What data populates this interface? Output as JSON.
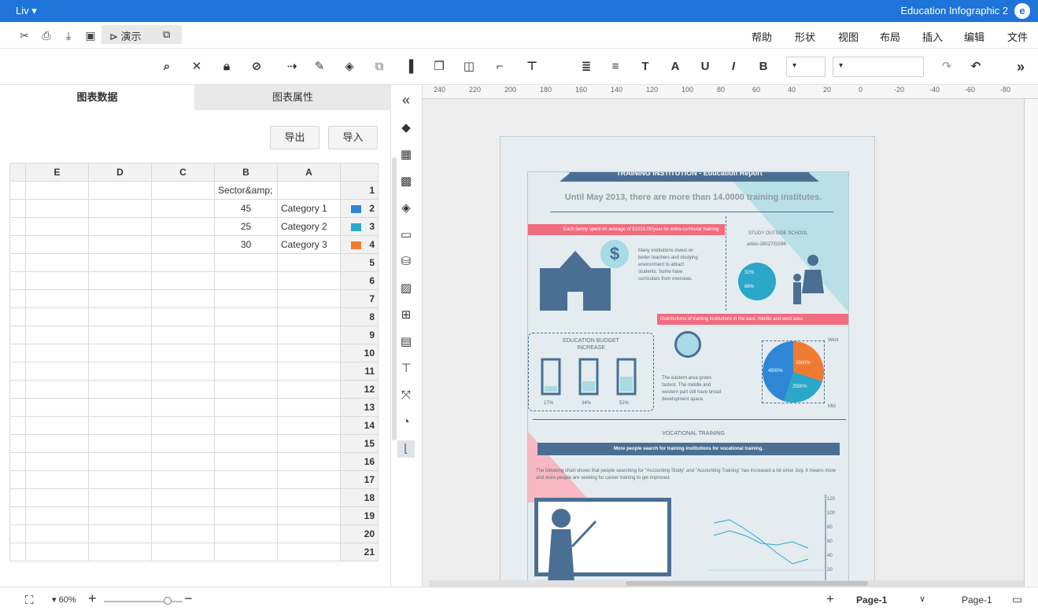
{
  "titlebar": {
    "user": "Liv",
    "app_title": "Education Infographic 2"
  },
  "menu": {
    "present_label": "演示",
    "items": [
      "文件",
      "编辑",
      "插入",
      "布局",
      "视图",
      "形状",
      "帮助"
    ]
  },
  "panel": {
    "tabs": [
      "图表数据",
      "图表属性"
    ],
    "import_label": "导入",
    "export_label": "导出",
    "columns": [
      "A",
      "B",
      "C",
      "D",
      "E"
    ],
    "rows": [
      {
        "num": "1",
        "a": "",
        "b": "Sector&amp;",
        "swatch": ""
      },
      {
        "num": "2",
        "a": "Category 1",
        "b": "45",
        "swatch": "#2e86d4"
      },
      {
        "num": "3",
        "a": "Category 2",
        "b": "25",
        "swatch": "#2aa7c9"
      },
      {
        "num": "4",
        "a": "Category 3",
        "b": "30",
        "swatch": "#f07a32"
      },
      {
        "num": "5"
      },
      {
        "num": "6"
      },
      {
        "num": "7"
      },
      {
        "num": "8"
      },
      {
        "num": "9"
      },
      {
        "num": "10"
      },
      {
        "num": "11"
      },
      {
        "num": "12"
      },
      {
        "num": "13"
      },
      {
        "num": "14"
      },
      {
        "num": "15"
      },
      {
        "num": "16"
      },
      {
        "num": "17"
      },
      {
        "num": "18"
      },
      {
        "num": "19"
      },
      {
        "num": "20"
      },
      {
        "num": "21"
      }
    ]
  },
  "ruler": [
    "240",
    "220",
    "200",
    "180",
    "160",
    "140",
    "120",
    "100",
    "80",
    "60",
    "40",
    "20",
    "0",
    "-20",
    "-40",
    "-60",
    "-80"
  ],
  "poster": {
    "title": "TRAINING INSTITUTION - Education Report",
    "subtitle": "Until May 2013, there are more than 14.0000 training institutes.",
    "bar1": "Each family spent on average of $1218.00/year for extra-curricular training.",
    "study_title": "STUDY OUTSIDE SCHOOL",
    "study_sub": "adoio-28027/02/86",
    "pie_small": [
      "32%",
      "68%"
    ],
    "invest_text": "Many institutions invest on better teachers and studying environment to attract students. Some have curriculars from overseas.",
    "bar2": "Distributions of training institutions in the east, middle and west area.",
    "budget_title": "EDUCATION BUDGET INCREASE",
    "budget_values": [
      "17%",
      "34%",
      "52%"
    ],
    "globe_text": "The eastern area grows fastest. The middle and western part still have broad development space.",
    "pie_labels": [
      "3000%",
      "4500%",
      "2500%"
    ],
    "pie_axis": [
      "West",
      "Mid"
    ],
    "vocational": "VOCATIONAL TRAINING",
    "bar3": "More people search for training institutions for vocational training.",
    "voc_text": "The following chart shows that people searching for \"Accounting Study\" and \"Accounting Training\" has increased a lot since July. It means more and more people are seeking for career training to get improved.",
    "y_ticks": [
      "120",
      "100",
      "80",
      "60",
      "40",
      "20"
    ]
  },
  "status": {
    "page_label": "Page-1",
    "page_tab": "Page-1",
    "zoom": "60%"
  }
}
